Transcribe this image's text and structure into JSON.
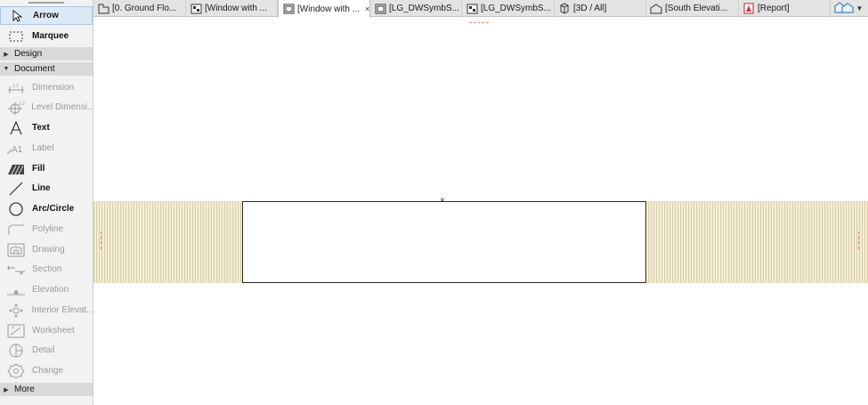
{
  "toolbox": {
    "tools_top": [
      {
        "label": "Arrow",
        "icon": "arrow-pointer-icon",
        "state": "active"
      },
      {
        "label": "Marquee",
        "icon": "marquee-icon",
        "state": "bold"
      }
    ],
    "sections": {
      "design": "Design",
      "document": "Document",
      "more": "More"
    },
    "document_tools": [
      {
        "label": "Dimension",
        "icon": "dimension-icon",
        "state": "disabled"
      },
      {
        "label": "Level Dimensi...",
        "icon": "level-dimension-icon",
        "state": "disabled"
      },
      {
        "label": "Text",
        "icon": "text-tool-icon",
        "state": "bold"
      },
      {
        "label": "Label",
        "icon": "label-tool-icon",
        "state": "disabled"
      },
      {
        "label": "Fill",
        "icon": "fill-tool-icon",
        "state": "bold"
      },
      {
        "label": "Line",
        "icon": "line-tool-icon",
        "state": "bold"
      },
      {
        "label": "Arc/Circle",
        "icon": "arc-circle-icon",
        "state": "bold"
      },
      {
        "label": "Polyline",
        "icon": "polyline-icon",
        "state": "disabled"
      },
      {
        "label": "Drawing",
        "icon": "drawing-icon",
        "state": "disabled"
      },
      {
        "label": "Section",
        "icon": "section-icon",
        "state": "disabled"
      },
      {
        "label": "Elevation",
        "icon": "elevation-icon",
        "state": "disabled"
      },
      {
        "label": "Interior Elevat...",
        "icon": "interior-elevation-icon",
        "state": "disabled"
      },
      {
        "label": "Worksheet",
        "icon": "worksheet-icon",
        "state": "disabled"
      },
      {
        "label": "Detail",
        "icon": "detail-icon",
        "state": "disabled"
      },
      {
        "label": "Change",
        "icon": "change-icon",
        "state": "disabled"
      }
    ]
  },
  "tabs": [
    {
      "label": "[0. Ground Flo...",
      "icon": "floor-plan-icon",
      "active": false
    },
    {
      "label": "[Window with ...",
      "icon": "symbol-window-icon",
      "active": false
    },
    {
      "label": "[Window with ...",
      "icon": "elevation-window-icon",
      "active": true,
      "close": "×"
    },
    {
      "label": "[LG_DWSymbS...",
      "icon": "elevation-window-icon",
      "active": false
    },
    {
      "label": "[LG_DWSymbS...",
      "icon": "symbol-window-icon",
      "active": false
    },
    {
      "label": "[3D / All]",
      "icon": "3d-view-icon",
      "active": false
    },
    {
      "label": "[South Elevati...",
      "icon": "elevation-house-icon",
      "active": false
    },
    {
      "label": "[Report]",
      "icon": "report-icon",
      "active": false
    }
  ],
  "home_tab": {
    "icon": "home-navigator-icon",
    "dropdown": "chevron-down-icon"
  },
  "canvas": {
    "origin_mark": "×",
    "colors": {
      "wall_fill": "#f4efd9",
      "hatch": "#d8cda0",
      "opening_stroke": "#2a2a2a",
      "accent": "#e08a5a"
    }
  }
}
